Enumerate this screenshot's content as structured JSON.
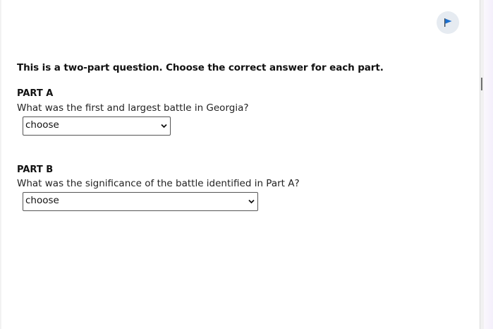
{
  "toolbar": {
    "flag_icon": "flag-icon",
    "flag_color": "#1a6fd0"
  },
  "instructions": "This is a two-part question. Choose the correct answer for each part.",
  "part_a": {
    "label": "PART A",
    "question": "What was the first and largest battle in Georgia?",
    "select_value": "choose"
  },
  "part_b": {
    "label": "PART B",
    "question": "What was the significance of the battle identified in Part A?",
    "select_value": "choose"
  }
}
